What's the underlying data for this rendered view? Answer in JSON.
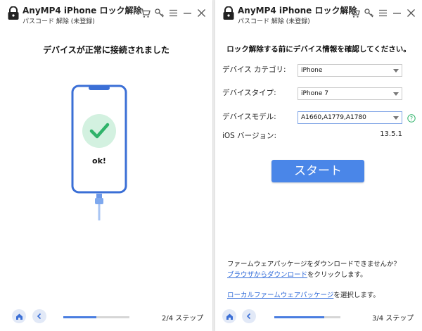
{
  "app": {
    "title": "AnyMP4 iPhone ロック解除",
    "subtitle": "パスコード 解除 (未登録)"
  },
  "toolbar_icons": [
    "cart-icon",
    "key-icon",
    "menu-icon",
    "minimize-icon",
    "close-icon"
  ],
  "left": {
    "heading": "デバイスが正常に接続されました",
    "ok_label": "ok!",
    "step_label": "2/4 ステップ",
    "progress": 0.5
  },
  "right": {
    "heading": "ロック解除する前にデバイス情報を確認してください。",
    "fields": [
      {
        "label": "デバイス カテゴリ:",
        "value": "iPhone"
      },
      {
        "label": "デバイスタイプ:",
        "value": "iPhone 7"
      },
      {
        "label": "デバイスモデル:",
        "value": "A1660,A1779,A1780"
      }
    ],
    "ios_label": "iOS バージョン:",
    "ios_value": "13.5.1",
    "start_label": "スタート",
    "download_question": "ファームウェアパッケージをダウンロードできませんか？",
    "browser_link": "ブラウザからダウンロード",
    "browser_suffix": "をクリックします。",
    "local_link": "ローカルファームウェアパッケージ",
    "local_suffix": "を選択します。",
    "step_label": "3/4 ステップ",
    "progress": 0.75
  },
  "colors": {
    "accent": "#4a86e8",
    "success": "#2fb36a",
    "phone_outline": "#3b6fd6",
    "link": "#2f6ad9"
  }
}
